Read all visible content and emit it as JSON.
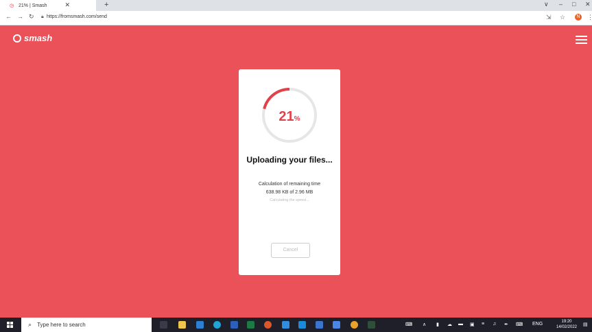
{
  "browser": {
    "tab_title": "21% | Smash",
    "url": "https://fromsmash.com/send",
    "profile_initial": "N"
  },
  "app": {
    "logo_text": "smash"
  },
  "upload": {
    "percent_value": "21",
    "percent_symbol": "%",
    "progress_fraction": 0.21,
    "title": "Uploading your files...",
    "remaining_time_label": "Calculation of remaining time",
    "size_progress": "638.98 KB of 2.96 MB",
    "speed_status": "Calculating the speed...",
    "cancel_label": "Cancel"
  },
  "taskbar": {
    "search_placeholder": "Type here to search",
    "language": "ENG",
    "time": "19:20",
    "date": "14/02/2022"
  },
  "colors": {
    "brand_background": "#ea5158",
    "accent": "#e0414b",
    "track": "#e6e6e6"
  }
}
